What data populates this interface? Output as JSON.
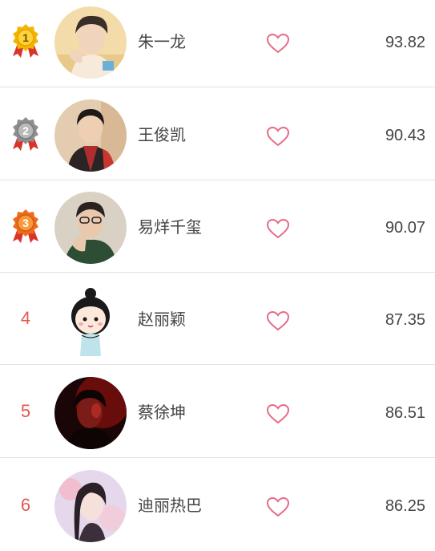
{
  "colors": {
    "rank_number": "#e8564e",
    "heart_outline": "#e76b86",
    "divider": "#e3e3e3",
    "text": "#444444"
  },
  "ranking": [
    {
      "rank": "1",
      "badge": "gold-medal-icon",
      "name": "朱一龙",
      "score": "93.82",
      "avatar": "portrait-photo"
    },
    {
      "rank": "2",
      "badge": "silver-medal-icon",
      "name": "王俊凯",
      "score": "90.43",
      "avatar": "portrait-photo"
    },
    {
      "rank": "3",
      "badge": "bronze-medal-icon",
      "name": "易烊千玺",
      "score": "90.07",
      "avatar": "portrait-photo"
    },
    {
      "rank": "4",
      "badge": null,
      "name": "赵丽颖",
      "score": "87.35",
      "avatar": "cartoon-girl-avatar"
    },
    {
      "rank": "5",
      "badge": null,
      "name": "蔡徐坤",
      "score": "86.51",
      "avatar": "portrait-photo"
    },
    {
      "rank": "6",
      "badge": null,
      "name": "迪丽热巴",
      "score": "86.25",
      "avatar": "portrait-photo"
    }
  ]
}
